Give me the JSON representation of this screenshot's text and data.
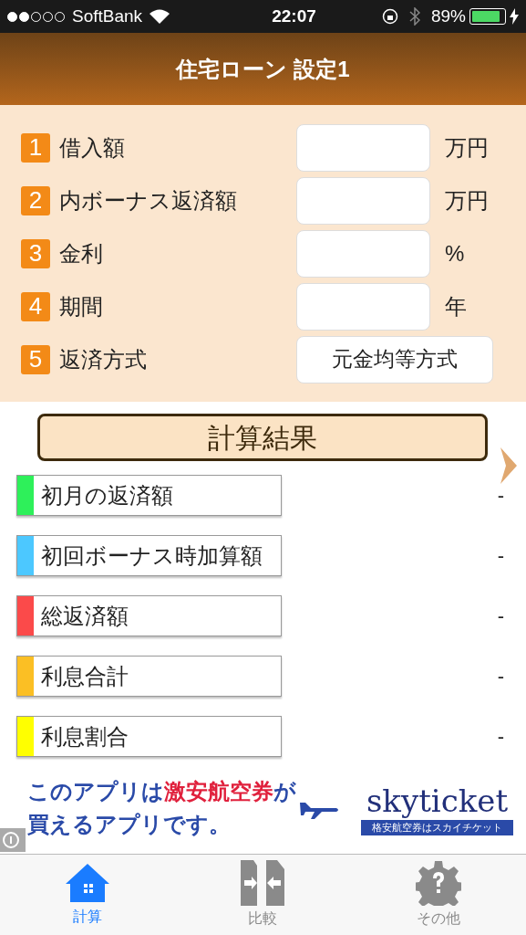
{
  "status_bar": {
    "carrier": "SoftBank",
    "time": "22:07",
    "battery": "89%"
  },
  "header": {
    "title": "住宅ローン 設定1"
  },
  "form": [
    {
      "number": "1",
      "label": "借入額",
      "kind": "input",
      "unit": "万円"
    },
    {
      "number": "2",
      "label": "内ボーナス返済額",
      "kind": "input",
      "unit": "万円"
    },
    {
      "number": "3",
      "label": "金利",
      "kind": "input",
      "unit": "%"
    },
    {
      "number": "4",
      "label": "期間",
      "kind": "input",
      "unit": "年"
    },
    {
      "number": "5",
      "label": "返済方式",
      "kind": "select",
      "value": "元金均等方式"
    }
  ],
  "results": {
    "title": "計算結果",
    "rows": [
      {
        "label": "初月の返済額",
        "color": "#2ef05a",
        "value": "-"
      },
      {
        "label": "初回ボーナス時加算額",
        "color": "#4cc8ff",
        "value": "-"
      },
      {
        "label": "総返済額",
        "color": "#fb4a4a",
        "value": "-"
      },
      {
        "label": "利息合計",
        "color": "#fbbf24",
        "value": "-"
      },
      {
        "label": "利息割合",
        "color": "#ffff00",
        "value": "-"
      }
    ]
  },
  "ad": {
    "lines": [
      [
        {
          "text": "このアプリは",
          "highlight": false
        },
        {
          "text": "激安航空券",
          "highlight": true
        },
        {
          "text": "が",
          "highlight": false
        }
      ],
      [
        {
          "text": "買えるアプリです。",
          "highlight": false
        }
      ]
    ],
    "brand": "skyticket",
    "tagline": "格安航空券はスカイチケット"
  },
  "tabs": [
    {
      "label": "計算",
      "selected": true
    },
    {
      "label": "比較",
      "selected": false
    },
    {
      "label": "その他",
      "selected": false
    }
  ]
}
